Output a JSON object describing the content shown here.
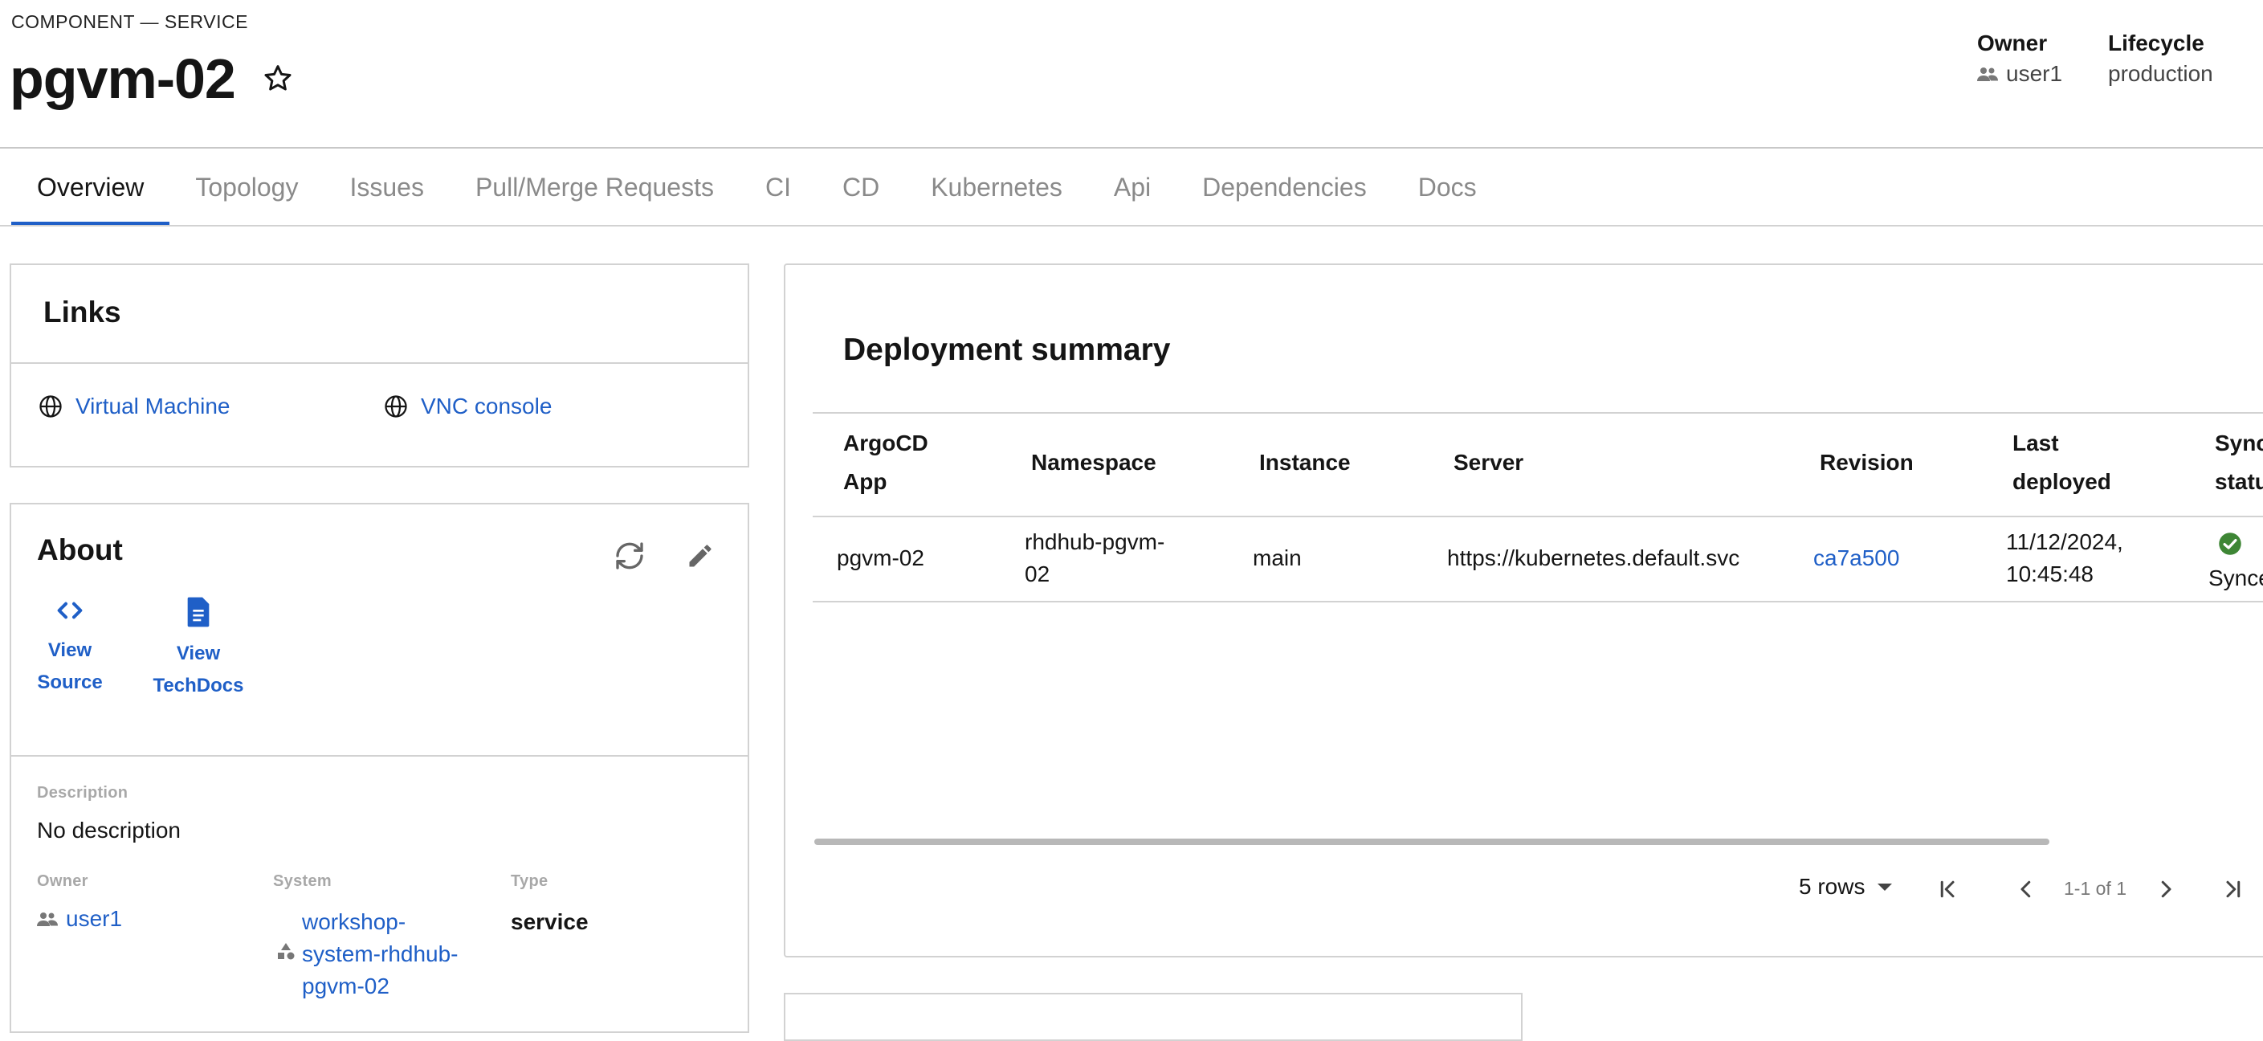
{
  "header": {
    "kind": "COMPONENT — SERVICE",
    "title": "pgvm-02",
    "owner_label": "Owner",
    "owner_value": "user1",
    "lifecycle_label": "Lifecycle",
    "lifecycle_value": "production"
  },
  "tabs": [
    {
      "label": "Overview",
      "active": true
    },
    {
      "label": "Topology"
    },
    {
      "label": "Issues"
    },
    {
      "label": "Pull/Merge Requests"
    },
    {
      "label": "CI"
    },
    {
      "label": "CD"
    },
    {
      "label": "Kubernetes"
    },
    {
      "label": "Api"
    },
    {
      "label": "Dependencies"
    },
    {
      "label": "Docs"
    }
  ],
  "links_card": {
    "title": "Links",
    "items": [
      {
        "label": "Virtual Machine",
        "icon": "globe-icon"
      },
      {
        "label": "VNC console",
        "icon": "globe-icon"
      }
    ]
  },
  "about_card": {
    "title": "About",
    "view_source_line1": "View",
    "view_source_line2": "Source",
    "view_techdocs_line1": "View",
    "view_techdocs_line2": "TechDocs",
    "description_label": "Description",
    "description_value": "No description",
    "owner_label": "Owner",
    "owner_value": "user1",
    "system_label": "System",
    "system_line1": "workshop-",
    "system_line2": "system-rhdhub-",
    "system_line3": "pgvm-02",
    "type_label": "Type",
    "type_value": "service"
  },
  "deployment": {
    "title": "Deployment summary",
    "headers": {
      "app_line1": "ArgoCD",
      "app_line2": "App",
      "namespace": "Namespace",
      "instance": "Instance",
      "server": "Server",
      "revision": "Revision",
      "last_line1": "Last",
      "last_line2": "deployed",
      "sync_line1": "Sync",
      "sync_line2": "status"
    },
    "row": {
      "app": "pgvm-02",
      "namespace_line1": "rhdhub-pgvm-",
      "namespace_line2": "02",
      "instance": "main",
      "server": "https://kubernetes.default.svc",
      "revision": "ca7a500",
      "date_line1": "11/12/2024,",
      "date_line2": "10:45:48",
      "sync": "Synced"
    },
    "pagination": {
      "rows_label": "5 rows",
      "range": "1-1 of 1"
    }
  },
  "colors": {
    "link": "#1f5fc7",
    "accent": "#1f5fc7",
    "success": "#3e8635"
  }
}
